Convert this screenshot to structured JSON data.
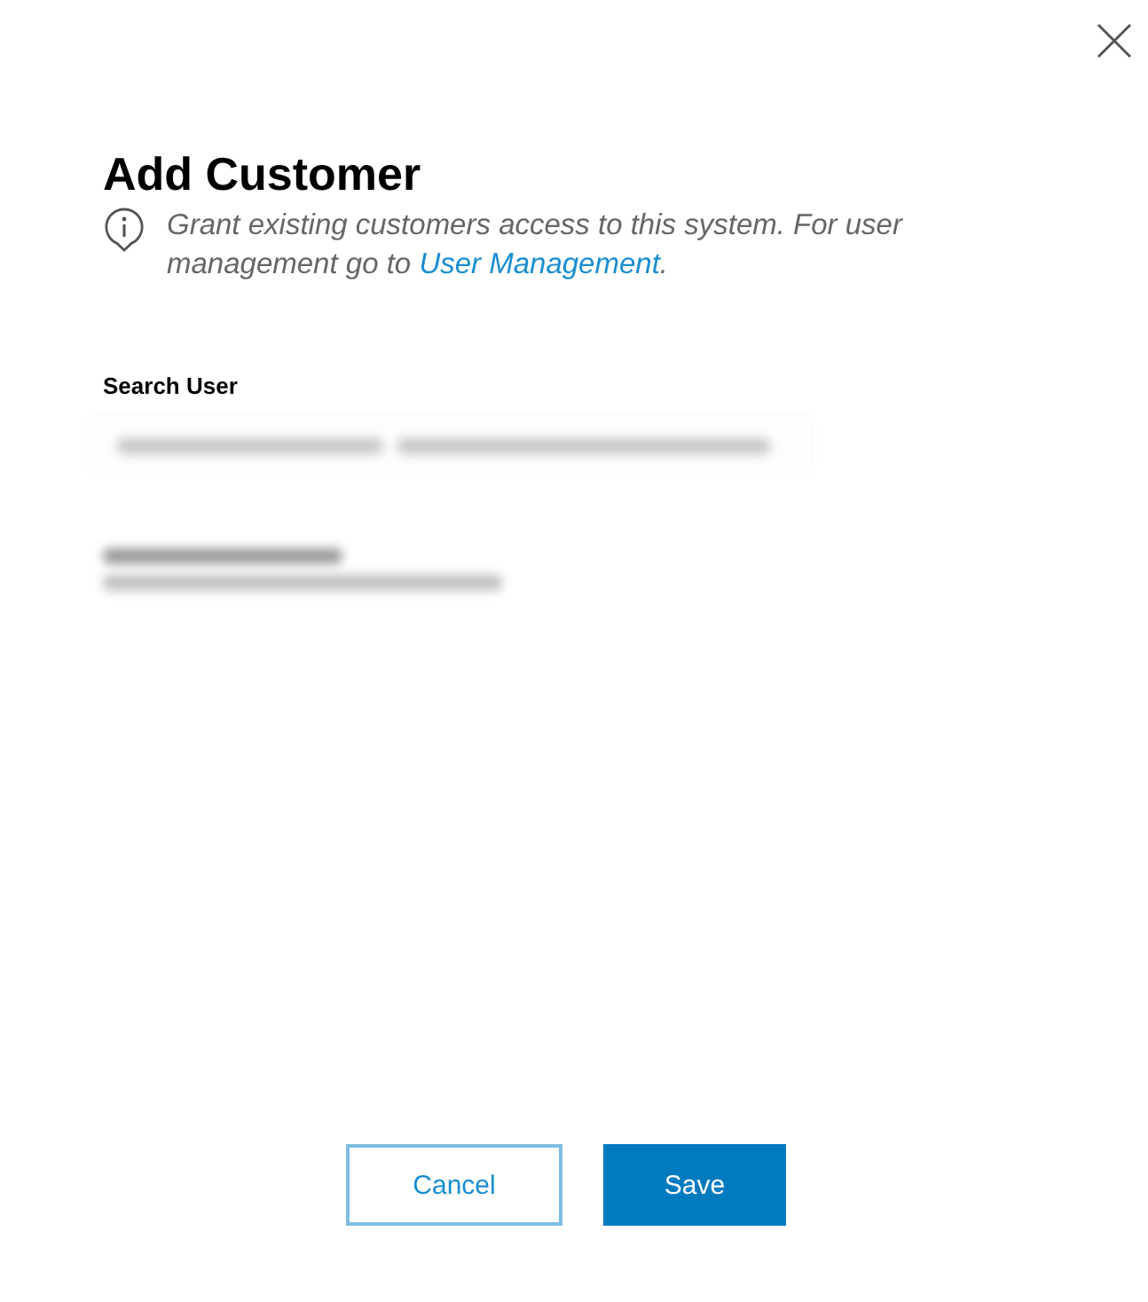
{
  "dialog": {
    "title": "Add Customer",
    "info": {
      "text": "Grant existing customers access to this system. For user management go to ",
      "link": "User Management",
      "end": "."
    },
    "search": {
      "label": "Search User"
    },
    "buttons": [
      {
        "label": "Cancel",
        "kind": "secondary"
      },
      {
        "label": "Save",
        "kind": "primary"
      }
    ]
  }
}
